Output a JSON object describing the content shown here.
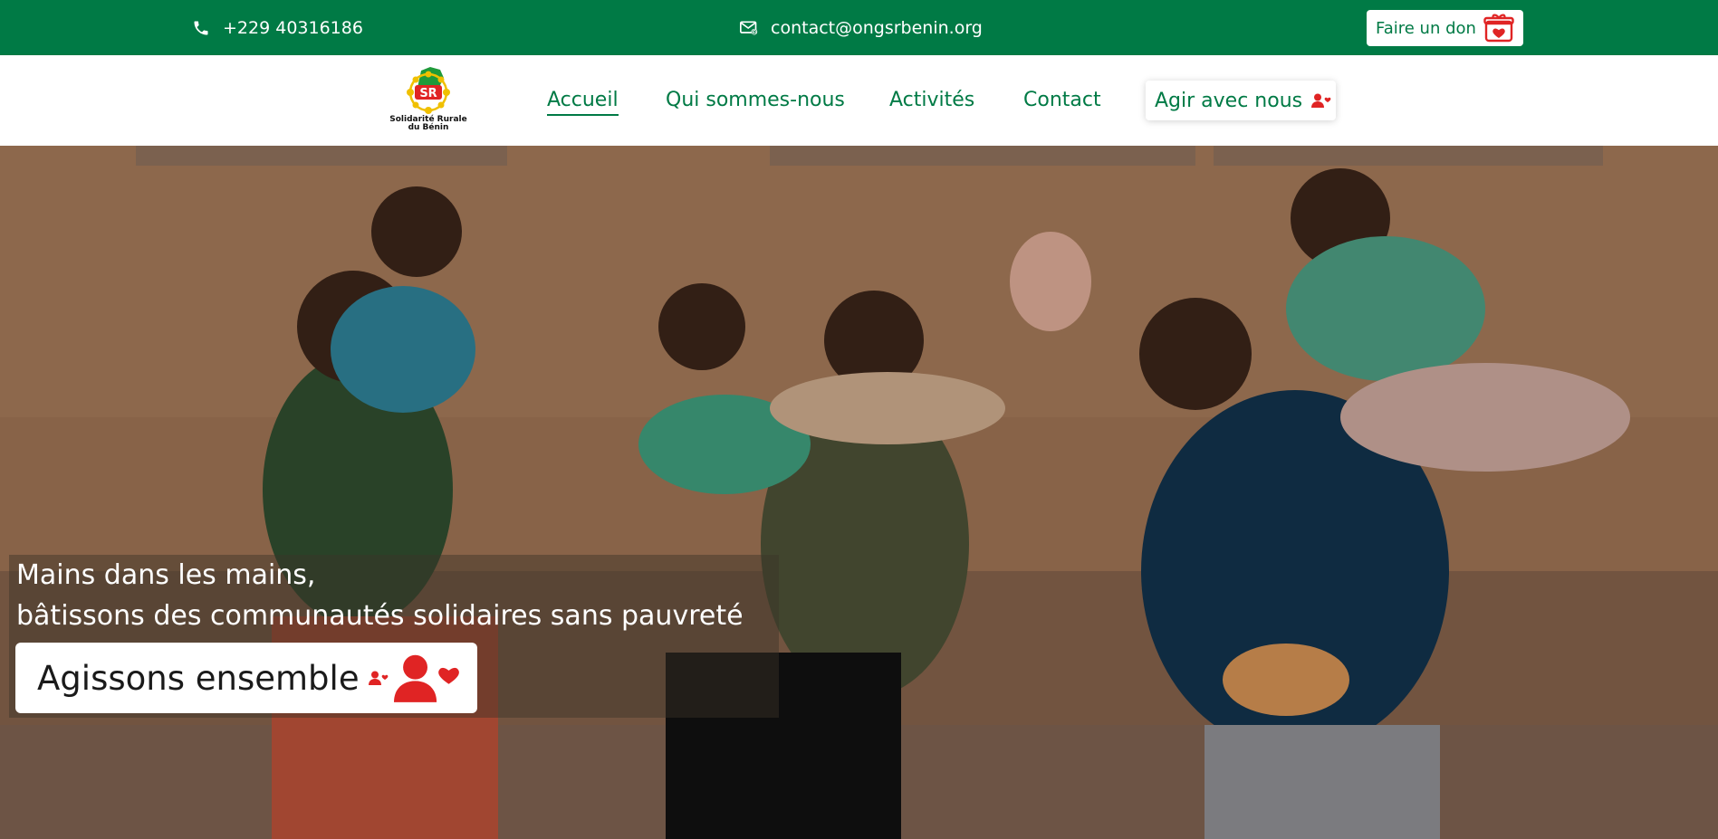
{
  "topbar": {
    "phone": "+229 40316186",
    "email": "contact@ongsrbenin.org",
    "donate_label": "Faire un don",
    "phone_icon": "phone-icon",
    "email_icon": "email-icon",
    "donate_icon": "gift-heart-icon"
  },
  "logo": {
    "initials": "SR",
    "caption_line1": "Solidarité Rurale",
    "caption_line2": "du Bénin"
  },
  "nav": {
    "items": [
      {
        "label": "Accueil",
        "active": true
      },
      {
        "label": "Qui sommes-nous",
        "active": false
      },
      {
        "label": "Activités",
        "active": false
      },
      {
        "label": "Contact",
        "active": false
      }
    ],
    "cta_label": "Agir avec nous",
    "cta_icon": "user-heart-icon"
  },
  "hero": {
    "line1": "Mains dans les mains,",
    "line2": "bâtissons des communautés solidaires sans pauvreté",
    "button_label": "Agissons ensemble",
    "button_icon": "user-heart-icon"
  },
  "colors": {
    "brand_green": "#007a45",
    "accent_red": "#e02424",
    "white": "#ffffff"
  }
}
